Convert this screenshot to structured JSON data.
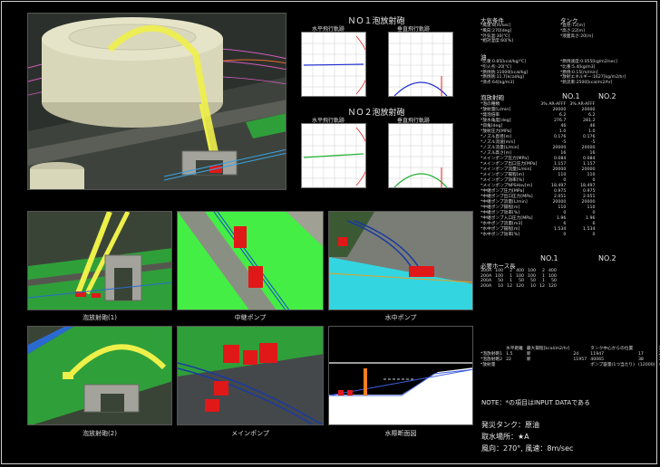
{
  "captions": {
    "main_view": "",
    "view1": "泡放射砲(1)",
    "view2": "中継ポンプ",
    "view3": "水中ポンプ",
    "view4": "泡放射砲(2)",
    "view5": "メインポンプ",
    "view6": "水際断面図"
  },
  "trajectory": {
    "section1": "ＮＯ１泡放射砲",
    "section2": "ＮＯ２泡放射砲",
    "horizontal": "水平飛行軌跡",
    "vertical": "垂直飛行軌跡"
  },
  "conditions": {
    "weather_title": "大気条件",
    "weather_lines": [
      "*風速:8[m/sec]",
      "*風向:270[deg]",
      "*外気温:30[℃]",
      "*相対湿度:60[%]"
    ],
    "tank_title": "タンク",
    "tank_lines": [
      "*直径:72[m]",
      "*高さ:22[m]",
      "*液面高さ:20[m]"
    ],
    "oil_title": "油",
    "oil_left": [
      "*比重:0.85[kcal/kg/℃]",
      "*引火点:-20[℃]",
      "*燃焼熱:11000[kcal/kg]",
      "*燃焼熱:11.7[kcal/kg]",
      "*沸点:64[kg/m3]"
    ],
    "oil_right": [
      "*燃焼速度:0.055[kg/m2/sec]",
      "*比重:5.4[kg/m3]",
      "*燃焼:0.15[m/min]",
      "*放射エネルギー:1627[kg/m2/hr]",
      "*熱流束:2500[kcal/m2/hr]"
    ]
  },
  "foam": {
    "title": "泡放射砲",
    "col1": "NO.1",
    "col2": "NO.2",
    "rows": [
      [
        "*泡の種類",
        "3% AR-AFFF",
        "3% AR-AFFF"
      ],
      [
        "*放射量[L/min]",
        "20000",
        "20000"
      ],
      [
        "*発泡倍率",
        "6.2",
        "6.2"
      ],
      [
        "*放水角度[deg]",
        "276.7",
        "281.2"
      ],
      [
        "*仰角[deg]",
        "46",
        "46"
      ],
      [
        "*放射圧力[MPa]",
        "1.0",
        "1.0"
      ],
      [
        "*ノズル直径[m]",
        "0.176",
        "0.176"
      ],
      [
        "*ノズル流速[m/s]",
        "-5",
        "-5"
      ],
      [
        "*ノズル流量[L/min]",
        "20000",
        "20000"
      ],
      [
        "*ノズル高さ[m]",
        "16",
        "16"
      ],
      [
        "*メインポンプ圧力[MPa]",
        "0.084",
        "0.084"
      ],
      [
        "*メインポンプ出口圧力[MPa]",
        "1.157",
        "1.157"
      ],
      [
        "*メインポンプ流量[L/min]",
        "20000",
        "20000"
      ],
      [
        "*メインポンプ揚程[m]",
        "110",
        "110"
      ],
      [
        "*メインポンプ効率[%]",
        "0",
        "0"
      ],
      [
        "*メインポンプNPSHav[m]",
        "18.497",
        "18.497"
      ],
      [
        "*中継ポンプ圧力[MPa]",
        "0.975",
        "0.975"
      ],
      [
        "*中継ポンプ出口圧力[MPa]",
        "2.051",
        "2.051"
      ],
      [
        "*中継ポンプ流量[L/min]",
        "20000",
        "20000"
      ],
      [
        "*中継ポンプ揚程[m]",
        "110",
        "110"
      ],
      [
        "*中継ポンプ効率[%]",
        "0",
        "0"
      ],
      [
        "*中継ポンプ入口圧力[MPa]",
        "1.96",
        "1.96"
      ],
      [
        "*水中ポンプ流量[m3]",
        "6",
        "6"
      ],
      [
        "*水中ポンプ揚程[m]",
        "1.534",
        "1.534"
      ],
      [
        "*水中ポンプ効率[%]",
        "0",
        "0"
      ]
    ]
  },
  "hose": {
    "title": "必要ホース長",
    "col1": "NO.1",
    "col2": "NO.2",
    "rows": [
      [
        "300A",
        "100",
        "2",
        "400",
        "100",
        "2",
        "400"
      ],
      [
        "200A",
        "100",
        "1",
        "100",
        "100",
        "1",
        "100"
      ],
      [
        "200A",
        "50",
        "1",
        "50",
        "50",
        "1",
        "50"
      ],
      [
        "200A",
        "10",
        "12",
        "120",
        "10",
        "12",
        "120"
      ]
    ]
  },
  "pumps": {
    "header": [
      "",
      "水平距離",
      "最大揚程[kcal/m2/hr]",
      "",
      "タンク中心からの位置",
      "",
      "流量[m]"
    ],
    "rows": [
      [
        "*泡放射砲1",
        "1.5",
        "新",
        "24",
        "11947",
        "17",
        "24"
      ],
      [
        "*泡放射砲2",
        "22",
        "新",
        "11957",
        "40065",
        "38",
        "38"
      ],
      [
        "*放射量",
        "",
        "",
        "",
        "ポンプ容量(1つ当たり)",
        "(12000)",
        "40[m3]"
      ]
    ]
  },
  "note": "NOTE：*の項目はINPUT DATAである",
  "footer": {
    "fire_tank": "発災タンク：原油",
    "site": "取水場所：★A",
    "wind": "風向：270°, 風速：8m/sec"
  },
  "colors": {
    "tank": "#e6e4c8",
    "stream": "#eef04a",
    "fire": "#e01818",
    "water": "#33d6e0",
    "grass": "#2f9f3a",
    "bright_green": "#44ee44"
  }
}
